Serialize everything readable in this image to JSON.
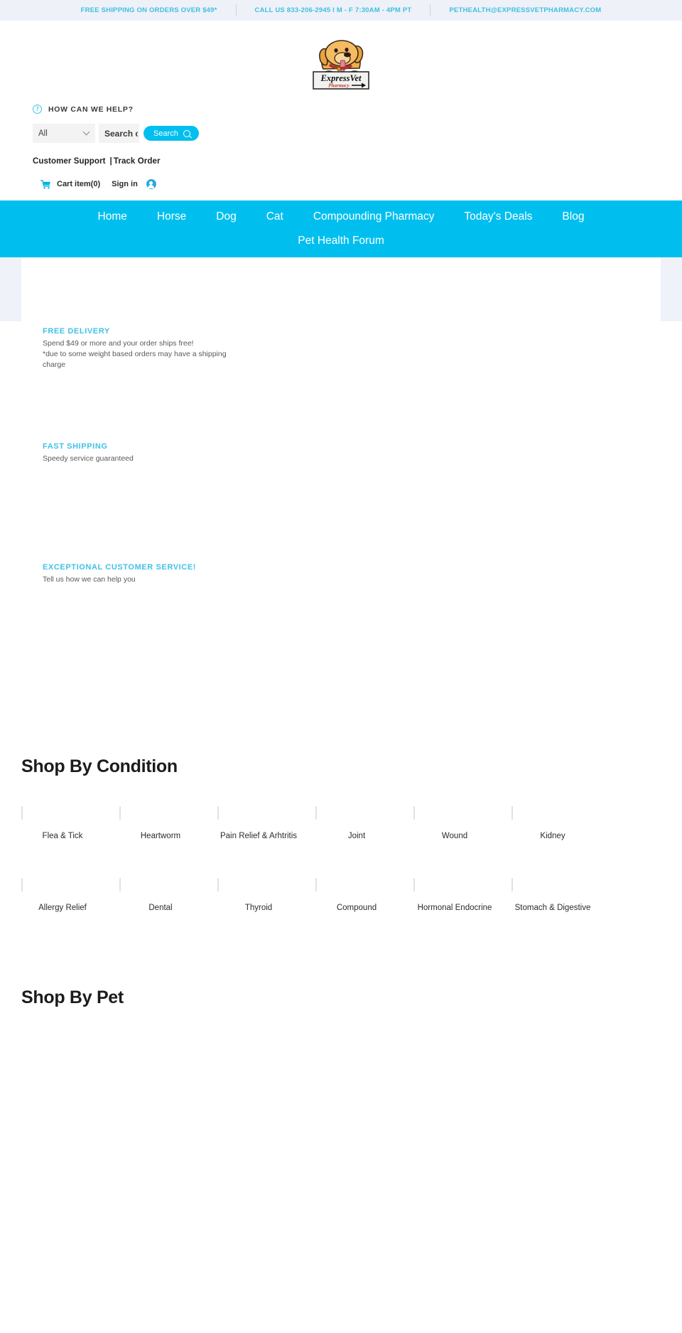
{
  "announcement": {
    "items": [
      "FREE SHIPPING ON ORDERS OVER $49*",
      "CALL US 833-206-2945 I M - F 7:30AM - 4PM PT",
      "PETHEALTH@EXPRESSVETPHARMACY.COM"
    ],
    "color": "#3fbfe0",
    "background": "#eef1f8"
  },
  "logo": {
    "brand_line1": "ExpressVet",
    "brand_line2": "Pharmacy",
    "alt": "ExpressVet Pharmacy dog logo"
  },
  "utility": {
    "help_label": "HOW CAN WE HELP?",
    "help_icon": "question-mark-circle-icon",
    "search": {
      "category_selected": "All",
      "category_options": [
        "All"
      ],
      "placeholder": "Search o",
      "value": "",
      "button_label": "Search",
      "button_icon": "magnifier-icon",
      "button_color": "#00bfef"
    },
    "links": {
      "customer_support": "Customer Support",
      "divider": "|",
      "track_order": "Track Order"
    },
    "cart": {
      "icon": "shopping-cart-icon",
      "label": "Cart item(0)",
      "count": 0
    },
    "account": {
      "label": "Sign in",
      "icon": "user-avatar-icon"
    }
  },
  "nav": {
    "background": "#00bfef",
    "row1": [
      "Home",
      "Horse",
      "Dog",
      "Cat",
      "Compounding Pharmacy",
      "Today's Deals",
      "Blog"
    ],
    "row2": [
      "Pet Health Forum"
    ]
  },
  "value_props": [
    {
      "title": "FREE DELIVERY",
      "lines": [
        "Spend $49 or more and your order ships free!",
        "*due to some weight based orders may have a shipping charge"
      ]
    },
    {
      "title": "FAST SHIPPING",
      "lines": [
        "Speedy service guaranteed"
      ]
    },
    {
      "title": "EXCEPTIONAL CUSTOMER SERVICE!",
      "lines": [
        "Tell us how we can help you"
      ]
    }
  ],
  "shop_by_condition": {
    "title": "Shop By Condition",
    "tiles": [
      "Flea & Tick",
      "Heartworm",
      "Pain Relief & Arhtritis",
      "Joint",
      "Wound",
      "Kidney",
      "Allergy Relief",
      "Dental",
      "Thyroid",
      "Compound",
      "Hormonal Endocrine",
      "Stomach & Digestive"
    ]
  },
  "shop_by_pet": {
    "title": "Shop By Pet"
  }
}
